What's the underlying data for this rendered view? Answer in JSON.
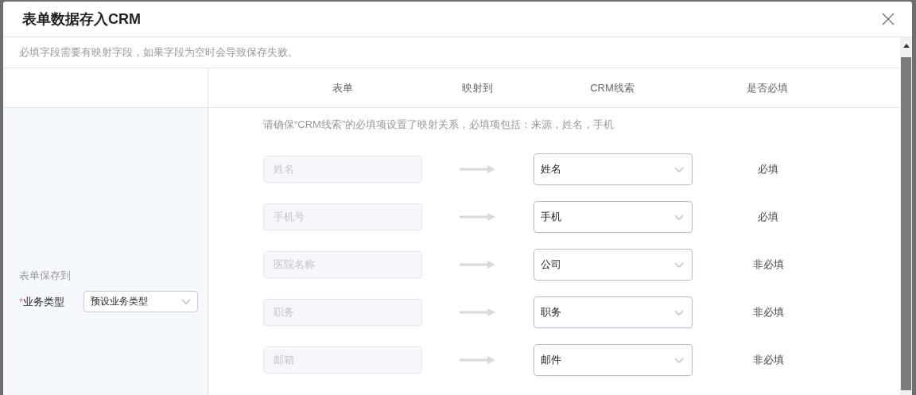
{
  "dialog": {
    "title": "表单数据存入CRM",
    "notice": "必填字段需要有映射字段，如果字段为空时会导致保存失败。"
  },
  "table": {
    "columns": [
      "表单",
      "映射到",
      "CRM线索",
      "是否必填"
    ],
    "hint": "请确保“CRM线索”的必填项设置了映射关系，必填项包括：来源，姓名，手机",
    "rows": [
      {
        "form_field": "姓名",
        "crm_field": "姓名",
        "required": "必填"
      },
      {
        "form_field": "手机号",
        "crm_field": "手机",
        "required": "必填"
      },
      {
        "form_field": "医院名称",
        "crm_field": "公司",
        "required": "非必填"
      },
      {
        "form_field": "职务",
        "crm_field": "职务",
        "required": "非必填"
      },
      {
        "form_field": "邮箱",
        "crm_field": "邮件",
        "required": "非必填"
      }
    ]
  },
  "save_to": {
    "heading": "表单保存到",
    "required_mark": "*",
    "label": "业务类型",
    "value": "预设业务类型"
  }
}
